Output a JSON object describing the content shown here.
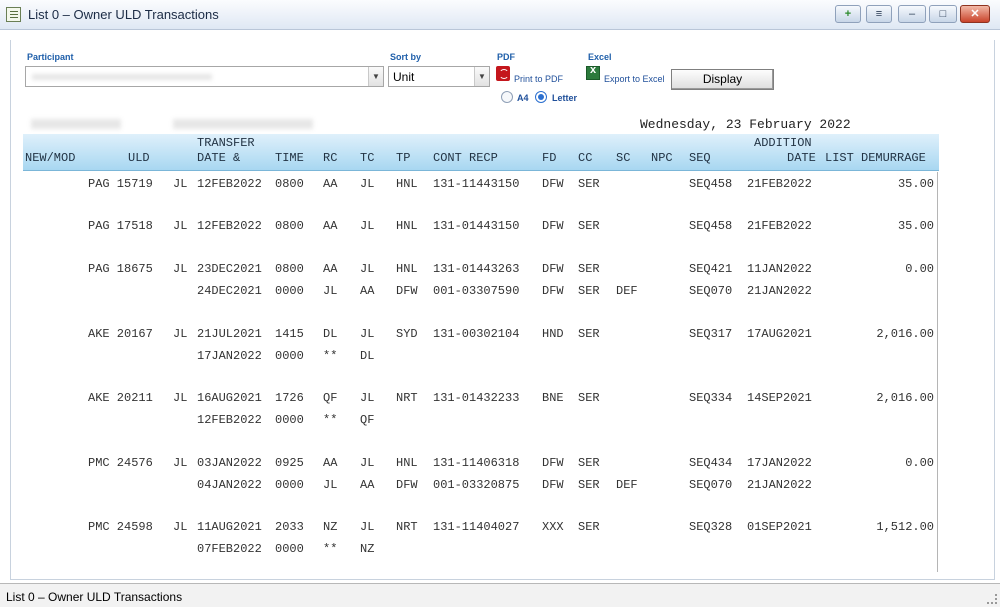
{
  "window": {
    "title": "List 0 – Owner ULD Transactions",
    "buttons": [
      {
        "name": "add-window-button",
        "glyph": "+"
      },
      {
        "name": "dock-button",
        "glyph": "≡"
      },
      {
        "name": "minimize-button",
        "glyph": "–"
      },
      {
        "name": "maximize-button",
        "glyph": "□"
      },
      {
        "name": "close-button",
        "glyph": "✕"
      }
    ]
  },
  "filters": {
    "participant_label": "Participant",
    "sortby_label": "Sort by",
    "sortby_value": "Unit",
    "pdf_label": "PDF",
    "print_pdf": "Print to PDF",
    "a4_label": "A4",
    "letter_label": "Letter",
    "paper_selected": "Letter",
    "excel_label": "Excel",
    "export_excel": "Export to Excel",
    "display_button": "Display"
  },
  "report": {
    "date_line": "Wednesday, 23 February 2022",
    "headers": {
      "new_mod": "NEW/MOD",
      "uld": "ULD",
      "transfer": "TRANSFER",
      "date": "DATE &",
      "time": "TIME",
      "rc": "RC",
      "tc": "TC",
      "tp": "TP",
      "cont_recp": "CONT RECP",
      "fd": "FD",
      "cc": "CC",
      "sc": "SC",
      "npc": "NPC",
      "seq": "SEQ",
      "addition": "ADDITION",
      "addition_date": "DATE",
      "list_demurrage": "LIST DEMURRAGE"
    },
    "rows": [
      {
        "uld": "PAG 15719",
        "own": "JL",
        "date": "12FEB2022",
        "time": "0800",
        "rc": "AA",
        "tc": "JL",
        "tp": "HNL",
        "cont": "131-11443150",
        "fd": "DFW",
        "cc": "SER",
        "sc": "",
        "seq": "SEQ458",
        "adate": "21FEB2022",
        "dem": "35.00"
      },
      {
        "uld": "PAG 17518",
        "own": "JL",
        "date": "12FEB2022",
        "time": "0800",
        "rc": "AA",
        "tc": "JL",
        "tp": "HNL",
        "cont": "131-01443150",
        "fd": "DFW",
        "cc": "SER",
        "sc": "",
        "seq": "SEQ458",
        "adate": "21FEB2022",
        "dem": "35.00"
      },
      {
        "uld": "PAG 18675",
        "own": "JL",
        "date": "23DEC2021",
        "time": "0800",
        "rc": "AA",
        "tc": "JL",
        "tp": "HNL",
        "cont": "131-01443263",
        "fd": "DFW",
        "cc": "SER",
        "sc": "",
        "seq": "SEQ421",
        "adate": "11JAN2022",
        "dem": "0.00"
      },
      {
        "uld": "",
        "own": "",
        "date": "24DEC2021",
        "time": "0000",
        "rc": "JL",
        "tc": "AA",
        "tp": "DFW",
        "cont": "001-03307590",
        "fd": "DFW",
        "cc": "SER",
        "sc": "DEF",
        "seq": "SEQ070",
        "adate": "21JAN2022",
        "dem": ""
      },
      {
        "uld": "AKE 20167",
        "own": "JL",
        "date": "21JUL2021",
        "time": "1415",
        "rc": "DL",
        "tc": "JL",
        "tp": "SYD",
        "cont": "131-00302104",
        "fd": "HND",
        "cc": "SER",
        "sc": "",
        "seq": "SEQ317",
        "adate": "17AUG2021",
        "dem": "2,016.00"
      },
      {
        "uld": "",
        "own": "",
        "date": "17JAN2022",
        "time": "0000",
        "rc": "**",
        "tc": "DL",
        "tp": "",
        "cont": "",
        "fd": "",
        "cc": "",
        "sc": "",
        "seq": "",
        "adate": "",
        "dem": ""
      },
      {
        "uld": "AKE 20211",
        "own": "JL",
        "date": "16AUG2021",
        "time": "1726",
        "rc": "QF",
        "tc": "JL",
        "tp": "NRT",
        "cont": "131-01432233",
        "fd": "BNE",
        "cc": "SER",
        "sc": "",
        "seq": "SEQ334",
        "adate": "14SEP2021",
        "dem": "2,016.00"
      },
      {
        "uld": "",
        "own": "",
        "date": "12FEB2022",
        "time": "0000",
        "rc": "**",
        "tc": "QF",
        "tp": "",
        "cont": "",
        "fd": "",
        "cc": "",
        "sc": "",
        "seq": "",
        "adate": "",
        "dem": ""
      },
      {
        "uld": "PMC 24576",
        "own": "JL",
        "date": "03JAN2022",
        "time": "0925",
        "rc": "AA",
        "tc": "JL",
        "tp": "HNL",
        "cont": "131-11406318",
        "fd": "DFW",
        "cc": "SER",
        "sc": "",
        "seq": "SEQ434",
        "adate": "17JAN2022",
        "dem": "0.00"
      },
      {
        "uld": "",
        "own": "",
        "date": "04JAN2022",
        "time": "0000",
        "rc": "JL",
        "tc": "AA",
        "tp": "DFW",
        "cont": "001-03320875",
        "fd": "DFW",
        "cc": "SER",
        "sc": "DEF",
        "seq": "SEQ070",
        "adate": "21JAN2022",
        "dem": ""
      },
      {
        "uld": "PMC 24598",
        "own": "JL",
        "date": "11AUG2021",
        "time": "2033",
        "rc": "NZ",
        "tc": "JL",
        "tp": "NRT",
        "cont": "131-11404027",
        "fd": "XXX",
        "cc": "SER",
        "sc": "",
        "seq": "SEQ328",
        "adate": "01SEP2021",
        "dem": "1,512.00"
      },
      {
        "uld": "",
        "own": "",
        "date": "07FEB2022",
        "time": "0000",
        "rc": "**",
        "tc": "NZ",
        "tp": "",
        "cont": "",
        "fd": "",
        "cc": "",
        "sc": "",
        "seq": "",
        "adate": "",
        "dem": ""
      }
    ]
  },
  "status": {
    "text": "List 0 – Owner ULD Transactions"
  }
}
